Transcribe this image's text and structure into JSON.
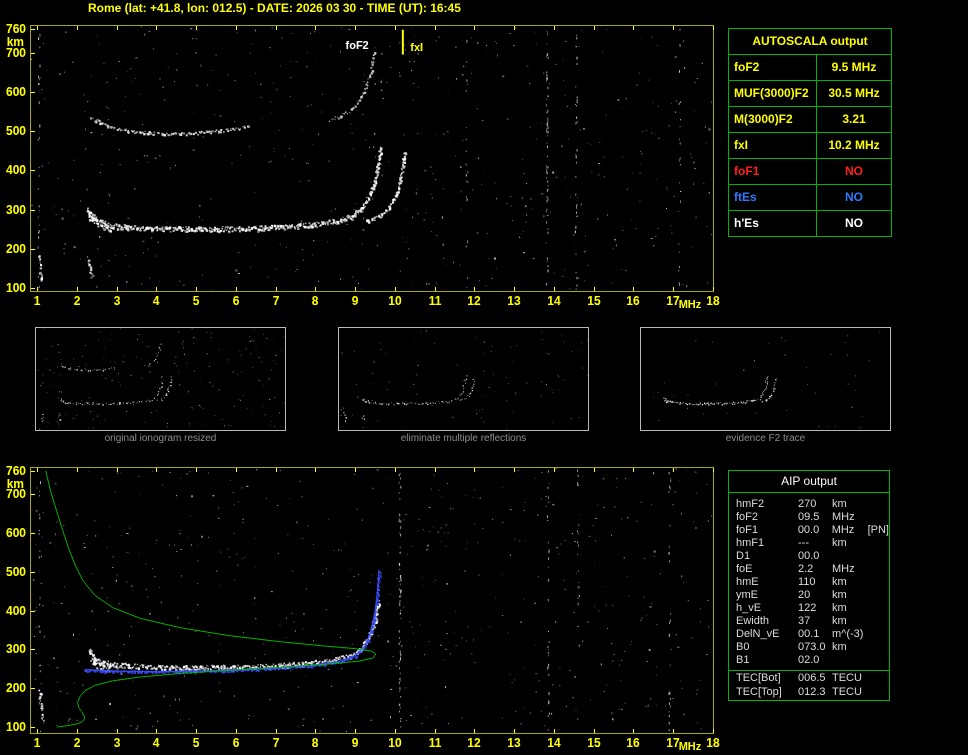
{
  "header": {
    "title": "Rome (lat: +41.8, lon: 012.5) - DATE: 2026 03 30 - TIME (UT): 16:45"
  },
  "colors": {
    "background": "#000000",
    "axis_yellow": "#ffff00",
    "border_yellow": "#a8a800",
    "table_green": "#00b400",
    "profile_green": "#00c000",
    "trace_white": "#ffffff",
    "restored_blue": "#3c50ff",
    "no_red": "#ff2020",
    "no_blue": "#2e7bff",
    "caption_gray": "#8f8f8f"
  },
  "autoscala": {
    "title": "AUTOSCALA output",
    "rows": [
      {
        "label": "foF2",
        "value": "9.5 MHz",
        "color": "#ffff00"
      },
      {
        "label": "MUF(3000)F2",
        "value": "30.5 MHz",
        "color": "#ffff00"
      },
      {
        "label": "M(3000)F2",
        "value": "3.21",
        "color": "#ffff00"
      },
      {
        "label": "fxI",
        "value": "10.2 MHz",
        "color": "#ffff00"
      },
      {
        "label": "foF1",
        "value": "NO",
        "color": "#ff2020"
      },
      {
        "label": "ftEs",
        "value": "NO",
        "color": "#2e7bff"
      },
      {
        "label": "h'Es",
        "value": "NO",
        "color": "#ffffff"
      }
    ]
  },
  "aip": {
    "title": "AIP output",
    "rows": [
      {
        "name": "hmF2",
        "value": "270",
        "unit": "km",
        "extra": "",
        "separator": false
      },
      {
        "name": "foF2",
        "value": "09.5",
        "unit": "MHz",
        "extra": "",
        "separator": false
      },
      {
        "name": "foF1",
        "value": "00.0",
        "unit": "MHz",
        "extra": "[PN]",
        "separator": false
      },
      {
        "name": "hmF1",
        "value": "---",
        "unit": "km",
        "extra": "",
        "separator": false
      },
      {
        "name": "D1",
        "value": "00.0",
        "unit": "",
        "extra": "",
        "separator": false
      },
      {
        "name": "foE",
        "value": "2.2",
        "unit": "MHz",
        "extra": "",
        "separator": false
      },
      {
        "name": "hmE",
        "value": "110",
        "unit": "km",
        "extra": "",
        "separator": false
      },
      {
        "name": "ymE",
        "value": "20",
        "unit": "km",
        "extra": "",
        "separator": false
      },
      {
        "name": "h_vE",
        "value": "122",
        "unit": "km",
        "extra": "",
        "separator": false
      },
      {
        "name": "Ewidth",
        "value": "37",
        "unit": "km",
        "extra": "",
        "separator": false
      },
      {
        "name": "DelN_vE",
        "value": "00.1",
        "unit": "m^(-3)",
        "extra": "",
        "separator": false
      },
      {
        "name": "B0",
        "value": "073.0",
        "unit": "km",
        "extra": "",
        "separator": false
      },
      {
        "name": "B1",
        "value": "02.0",
        "unit": "",
        "extra": "",
        "separator": false
      },
      {
        "name": "TEC[Bot]",
        "value": "006.5",
        "unit": "TECU",
        "extra": "",
        "separator": true
      },
      {
        "name": "TEC[Top]",
        "value": "012.3",
        "unit": "TECU",
        "extra": "",
        "separator": false
      }
    ]
  },
  "thumbnails": [
    {
      "caption": "original ionogram resized"
    },
    {
      "caption": "eliminate multiple reflections"
    },
    {
      "caption": "evidence F2 trace"
    }
  ],
  "chart_data": [
    {
      "id": "top-ionogram",
      "type": "scatter",
      "title": "",
      "xlabel": "MHz",
      "ylabel": "km",
      "xlim": [
        1,
        18
      ],
      "ylim": [
        100,
        760
      ],
      "x_ticks": [
        1,
        2,
        3,
        4,
        5,
        6,
        7,
        8,
        9,
        10,
        11,
        12,
        13,
        14,
        15,
        16,
        17,
        18
      ],
      "y_ticks": [
        100,
        200,
        300,
        400,
        500,
        600,
        700,
        760
      ],
      "annotations": [
        {
          "text": "foF2",
          "x": 9.05,
          "y": 718,
          "color": "#ffffff"
        },
        {
          "text": "fxI",
          "x": 10.55,
          "y": 714,
          "color": "#ffff00"
        }
      ],
      "vlines": [
        {
          "x": 10.2,
          "y1": 695,
          "y2": 758,
          "color": "#ffff00",
          "label": "fxI marker"
        }
      ],
      "series": [
        {
          "name": "F2 trace first hop",
          "color": "#ffffff",
          "style": "band",
          "thick": 5,
          "density": 1.5,
          "points": [
            [
              2.25,
              300
            ],
            [
              2.4,
              275
            ],
            [
              2.8,
              260
            ],
            [
              3.5,
              254
            ],
            [
              4.5,
              251
            ],
            [
              5.5,
              251
            ],
            [
              6.5,
              253
            ],
            [
              7.3,
              257
            ],
            [
              8.0,
              263
            ],
            [
              8.5,
              271
            ],
            [
              8.9,
              283
            ],
            [
              9.15,
              302
            ],
            [
              9.35,
              333
            ],
            [
              9.5,
              375
            ],
            [
              9.58,
              420
            ],
            [
              9.63,
              458
            ]
          ]
        },
        {
          "name": "F2 x-mode rise",
          "color": "#ffffff",
          "style": "band",
          "thick": 3,
          "density": 1.0,
          "points": [
            [
              9.25,
              270
            ],
            [
              9.55,
              282
            ],
            [
              9.8,
              300
            ],
            [
              9.98,
              328
            ],
            [
              10.1,
              365
            ],
            [
              10.18,
              408
            ],
            [
              10.23,
              448
            ]
          ]
        },
        {
          "name": "leading edge blob",
          "color": "#ffffff",
          "style": "band",
          "thick": 9,
          "density": 1.7,
          "points": [
            [
              2.28,
              292
            ],
            [
              2.5,
              268
            ],
            [
              2.8,
              258
            ]
          ]
        },
        {
          "name": "second hop arc",
          "color": "#e8e8e8",
          "style": "band",
          "thick": 3,
          "density": 0.8,
          "points": [
            [
              2.35,
              535
            ],
            [
              2.75,
              513
            ],
            [
              3.3,
              500
            ],
            [
              4.2,
              494
            ],
            [
              5.0,
              496
            ],
            [
              5.7,
              503
            ],
            [
              6.3,
              512
            ]
          ]
        },
        {
          "name": "second hop rise",
          "color": "#d8d8d8",
          "style": "band",
          "thick": 3,
          "density": 0.7,
          "points": [
            [
              8.35,
              528
            ],
            [
              8.75,
              545
            ],
            [
              9.05,
              572
            ],
            [
              9.25,
              608
            ],
            [
              9.38,
              652
            ],
            [
              9.47,
              700
            ]
          ]
        },
        {
          "name": "E region echoes",
          "color": "#ffffff",
          "style": "band",
          "thick": 4,
          "density": 0.55,
          "points": [
            [
              1.03,
              190
            ],
            [
              1.07,
              150
            ],
            [
              1.1,
              115
            ]
          ]
        },
        {
          "name": "Es patch",
          "color": "#e0e0e0",
          "style": "band",
          "thick": 3,
          "density": 0.55,
          "points": [
            [
              2.28,
              180
            ],
            [
              2.33,
              150
            ],
            [
              2.37,
              125
            ]
          ]
        }
      ],
      "noise": {
        "count": 520,
        "columns": [
          {
            "x": 1.04,
            "count": 25
          },
          {
            "x": 11.8,
            "count": 18
          },
          {
            "x": 13.82,
            "count": 60
          },
          {
            "x": 14.55,
            "count": 35
          },
          {
            "x": 17.15,
            "count": 22
          }
        ]
      }
    },
    {
      "id": "bottom-ionogram",
      "type": "scatter",
      "title": "",
      "xlabel": "MHz",
      "ylabel": "km",
      "xlim": [
        1,
        18
      ],
      "ylim": [
        100,
        760
      ],
      "x_ticks": [
        1,
        2,
        3,
        4,
        5,
        6,
        7,
        8,
        9,
        10,
        11,
        12,
        13,
        14,
        15,
        16,
        17,
        18
      ],
      "y_ticks": [
        100,
        200,
        300,
        400,
        500,
        600,
        700,
        760
      ],
      "annotations": [],
      "vlines": [],
      "series": [
        {
          "name": "F2 trace first hop",
          "color": "#ffffff",
          "style": "band",
          "thick": 5,
          "density": 1.3,
          "points": [
            [
              2.3,
              302
            ],
            [
              2.45,
              274
            ],
            [
              2.9,
              261
            ],
            [
              3.8,
              256
            ],
            [
              4.8,
              254
            ],
            [
              5.8,
              255
            ],
            [
              6.8,
              258
            ],
            [
              7.7,
              264
            ],
            [
              8.4,
              272
            ],
            [
              8.9,
              285
            ],
            [
              9.15,
              304
            ],
            [
              9.35,
              335
            ],
            [
              9.5,
              378
            ],
            [
              9.58,
              425
            ]
          ]
        },
        {
          "name": "leading edge blob",
          "color": "#ffffff",
          "style": "band",
          "thick": 10,
          "density": 1.8,
          "points": [
            [
              2.32,
              285
            ],
            [
              2.55,
              262
            ],
            [
              2.85,
              255
            ]
          ]
        },
        {
          "name": "restored F2 trace",
          "color": "#3c50ff",
          "style": "dotline",
          "thick": 2,
          "density": 0.9,
          "points": [
            [
              2.2,
              248
            ],
            [
              3.0,
              244
            ],
            [
              4.0,
              243
            ],
            [
              5.0,
              244
            ],
            [
              6.0,
              247
            ],
            [
              7.0,
              252
            ],
            [
              7.9,
              259
            ],
            [
              8.6,
              269
            ],
            [
              9.0,
              284
            ],
            [
              9.25,
              309
            ],
            [
              9.4,
              347
            ],
            [
              9.5,
              395
            ],
            [
              9.57,
              455
            ],
            [
              9.6,
              505
            ]
          ]
        },
        {
          "name": "electron density profile",
          "color": "#00c000",
          "style": "line",
          "thick": 1,
          "points": [
            [
              1.22,
              760
            ],
            [
              1.35,
              705
            ],
            [
              1.5,
              655
            ],
            [
              1.62,
              615
            ],
            [
              1.78,
              565
            ],
            [
              1.95,
              520
            ],
            [
              2.15,
              478
            ],
            [
              2.45,
              440
            ],
            [
              2.9,
              408
            ],
            [
              3.6,
              380
            ],
            [
              4.6,
              356
            ],
            [
              5.8,
              336
            ],
            [
              7.1,
              320
            ],
            [
              8.2,
              309
            ],
            [
              9.0,
              302
            ],
            [
              9.4,
              296
            ],
            [
              9.52,
              288
            ],
            [
              9.45,
              278
            ],
            [
              9.1,
              270
            ],
            [
              8.3,
              262
            ],
            [
              7.1,
              254
            ],
            [
              5.8,
              246
            ],
            [
              4.6,
              238
            ],
            [
              3.6,
              229
            ],
            [
              2.9,
              219
            ],
            [
              2.45,
              207
            ],
            [
              2.2,
              193
            ],
            [
              2.08,
              178
            ],
            [
              2.02,
              163
            ],
            [
              2.05,
              150
            ],
            [
              2.12,
              140
            ],
            [
              2.18,
              131
            ],
            [
              2.2,
              122
            ],
            [
              2.15,
              114
            ],
            [
              2.0,
              108
            ],
            [
              1.75,
              103
            ],
            [
              1.5,
              100
            ]
          ]
        },
        {
          "name": "E region echoes",
          "color": "#ffffff",
          "style": "band",
          "thick": 4,
          "density": 0.6,
          "points": [
            [
              1.05,
              195
            ],
            [
              1.1,
              150
            ],
            [
              1.14,
              112
            ]
          ]
        }
      ],
      "noise": {
        "count": 560,
        "columns": [
          {
            "x": 1.05,
            "count": 20
          },
          {
            "x": 10.12,
            "count": 70
          },
          {
            "x": 13.85,
            "count": 30
          },
          {
            "x": 14.6,
            "count": 20
          },
          {
            "x": 16.9,
            "count": 25
          }
        ]
      }
    }
  ]
}
